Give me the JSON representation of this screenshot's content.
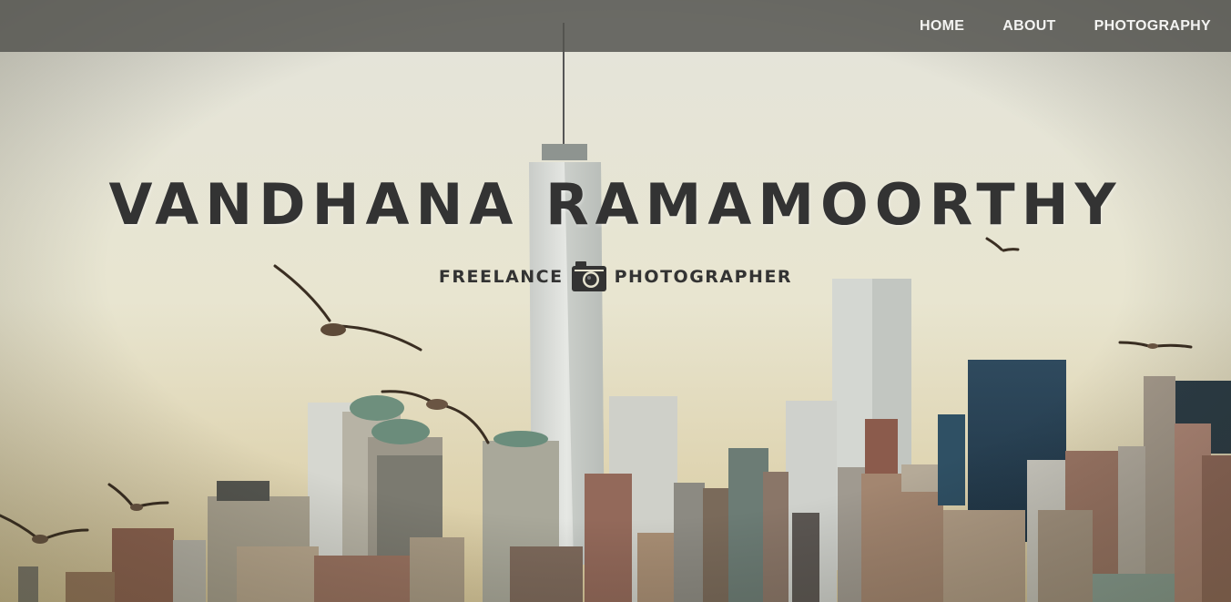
{
  "nav": {
    "items": [
      {
        "label": "HOME"
      },
      {
        "label": "ABOUT"
      },
      {
        "label": "PHOTOGRAPHY"
      }
    ]
  },
  "hero": {
    "title": "VANDHANA RAMAMOORTHY",
    "subtitle_left": "FREELANCE",
    "subtitle_icon": "camera-icon",
    "subtitle_right": "PHOTOGRAPHER",
    "background_image": "city-skyline-with-seagulls"
  },
  "colors": {
    "navbar": "#555550",
    "nav_text": "#f4f4f2",
    "title_text": "#333333"
  }
}
